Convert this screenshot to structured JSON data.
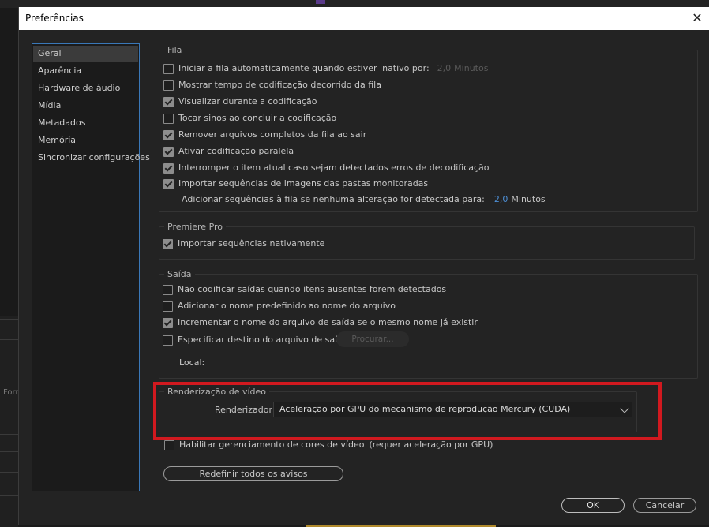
{
  "window": {
    "title": "Preferências"
  },
  "background": {
    "partial_text": "Forr"
  },
  "sidebar": {
    "items": [
      {
        "label": "Geral",
        "selected": true
      },
      {
        "label": "Aparência"
      },
      {
        "label": "Hardware de áudio"
      },
      {
        "label": "Mídia"
      },
      {
        "label": "Metadados"
      },
      {
        "label": "Memória"
      },
      {
        "label": "Sincronizar configurações"
      }
    ]
  },
  "queue": {
    "legend": "Fila",
    "items": [
      {
        "label": "Iniciar a fila automaticamente quando estiver inativo por:",
        "checked": false
      },
      {
        "label": "Mostrar tempo de codificação decorrido da fila",
        "checked": false
      },
      {
        "label": "Visualizar durante a codificação",
        "checked": true
      },
      {
        "label": "Tocar sinos ao concluir a codificação",
        "checked": false
      },
      {
        "label": "Remover arquivos completos da fila ao sair",
        "checked": true
      },
      {
        "label": "Ativar codificação paralela",
        "checked": true
      },
      {
        "label": "Interromper o item atual caso sejam detectados erros de decodificação",
        "checked": true
      },
      {
        "label": "Importar sequências de imagens das pastas monitoradas",
        "checked": true
      }
    ],
    "idle_value": "2,0",
    "idle_unit": "Minutos",
    "add_seq_label": "Adicionar sequências à fila se nenhuma alteração for detectada para:",
    "add_seq_value": "2,0",
    "add_seq_unit": "Minutos"
  },
  "premiere": {
    "legend": "Premiere Pro",
    "import_label": "Importar sequências nativamente",
    "import_checked": true
  },
  "output": {
    "legend": "Saída",
    "items": [
      {
        "label": "Não codificar saídas quando itens ausentes forem detectados",
        "checked": false
      },
      {
        "label": "Adicionar o nome predefinido ao nome do arquivo",
        "checked": false
      },
      {
        "label": "Incrementar o nome do arquivo de saída se o mesmo nome já existir",
        "checked": true
      },
      {
        "label": "Especificar destino do arquivo de saída:",
        "checked": false
      }
    ],
    "browse_label": "Procurar...",
    "local_label": "Local:"
  },
  "video_render": {
    "legend": "Renderização de vídeo",
    "renderer_label": "Renderizador:",
    "renderer_value": "Aceleração por GPU do mecanismo de reprodução Mercury (CUDA)"
  },
  "color_management": {
    "label": "Habilitar gerenciamento de cores de vídeo",
    "note": "(requer aceleração por GPU)",
    "checked": false
  },
  "buttons": {
    "reset_warnings": "Redefinir todos os avisos",
    "ok": "OK",
    "cancel": "Cancelar"
  },
  "colors": {
    "highlight_red": "#d1191f",
    "selection_blue": "#3a78b8",
    "value_blue": "#4d8fd6"
  }
}
